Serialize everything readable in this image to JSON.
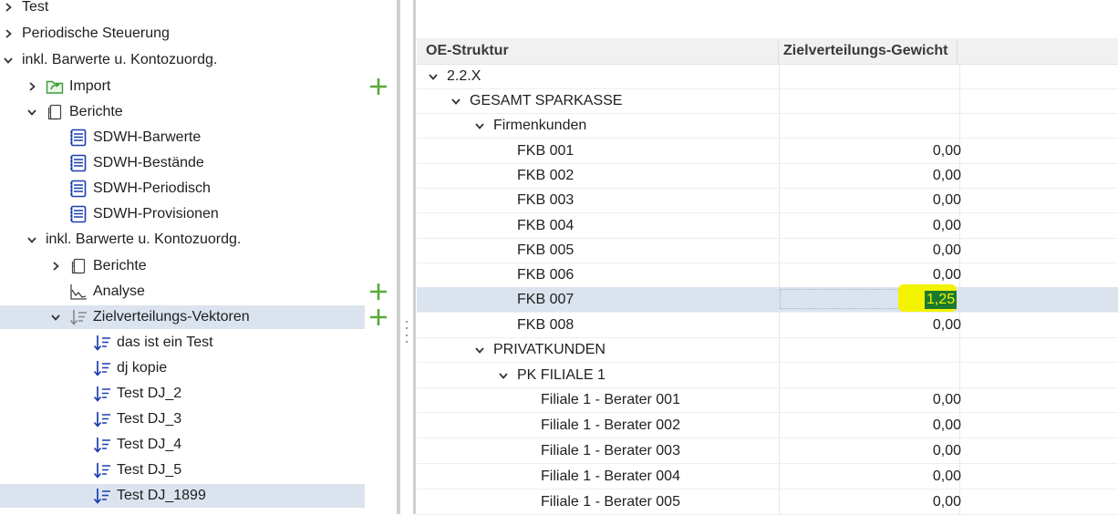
{
  "tree": {
    "items": [
      {
        "label": "Test"
      },
      {
        "label": "Periodische Steuerung"
      },
      {
        "label": "inkl. Barwerte u. Kontozuordg."
      },
      {
        "label": "Import"
      },
      {
        "label": "Berichte"
      },
      {
        "label": "SDWH-Barwerte"
      },
      {
        "label": "SDWH-Bestände"
      },
      {
        "label": "SDWH-Periodisch"
      },
      {
        "label": "SDWH-Provisionen"
      },
      {
        "label": "inkl. Barwerte u. Kontozuordg."
      },
      {
        "label": "Berichte"
      },
      {
        "label": "Analyse"
      },
      {
        "label": "Zielverteilungs-Vektoren"
      },
      {
        "label": "das ist ein Test"
      },
      {
        "label": "dj kopie"
      },
      {
        "label": "Test DJ_2"
      },
      {
        "label": "Test DJ_3"
      },
      {
        "label": "Test DJ_4"
      },
      {
        "label": "Test DJ_5"
      },
      {
        "label": "Test DJ_1899"
      }
    ]
  },
  "grid": {
    "columns": [
      "OE-Struktur",
      "Zielverteilungs-Gewicht"
    ],
    "rows": [
      {
        "name": "2.2.X",
        "value": ""
      },
      {
        "name": "GESAMT SPARKASSE",
        "value": ""
      },
      {
        "name": "Firmenkunden",
        "value": ""
      },
      {
        "name": "FKB 001",
        "value": "0,00"
      },
      {
        "name": "FKB 002",
        "value": "0,00"
      },
      {
        "name": "FKB 003",
        "value": "0,00"
      },
      {
        "name": "FKB 004",
        "value": "0,00"
      },
      {
        "name": "FKB 005",
        "value": "0,00"
      },
      {
        "name": "FKB 006",
        "value": "0,00"
      },
      {
        "name": "FKB 007",
        "value": "1,25"
      },
      {
        "name": "FKB 008",
        "value": "0,00"
      },
      {
        "name": "PRIVATKUNDEN",
        "value": ""
      },
      {
        "name": "PK FILIALE 1",
        "value": ""
      },
      {
        "name": "Filiale 1 - Berater 001",
        "value": "0,00"
      },
      {
        "name": "Filiale 1 - Berater 002",
        "value": "0,00"
      },
      {
        "name": "Filiale 1 - Berater 003",
        "value": "0,00"
      },
      {
        "name": "Filiale 1 - Berater 004",
        "value": "0,00"
      },
      {
        "name": "Filiale 1 - Berater 005",
        "value": "0,00"
      }
    ]
  },
  "colors": {
    "selection": "#dbe3ee",
    "add_green": "#5aa83a",
    "report_blue": "#1a3fb0",
    "highlight_yellow": "#f3f300",
    "edit_green": "#1b7a2e"
  }
}
